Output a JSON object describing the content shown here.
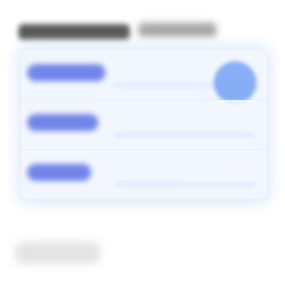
{
  "header": {
    "title": "",
    "subtitle": ""
  },
  "list": {
    "rows": [
      {
        "label": ""
      },
      {
        "label": ""
      },
      {
        "label": ""
      }
    ]
  },
  "footer": {
    "label": ""
  },
  "colors": {
    "accent": "#5b72e4",
    "row_background": "#f0f6ff",
    "circle_accent": "#7aa7f5"
  }
}
